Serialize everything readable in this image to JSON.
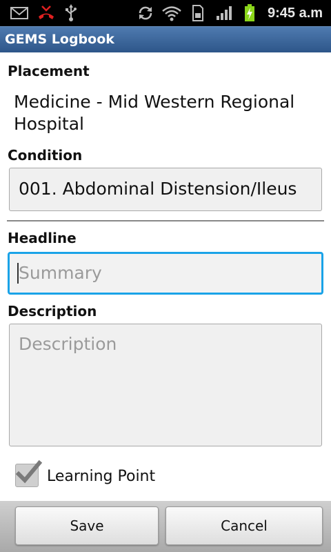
{
  "status_bar": {
    "time": "9:45 a.m",
    "icons": [
      "gmail-icon",
      "missed-call-icon",
      "usb-icon",
      "sync-icon",
      "wifi-icon",
      "sd-card-icon",
      "signal-icon",
      "battery-charging-icon"
    ]
  },
  "app": {
    "title": "GEMS Logbook"
  },
  "form": {
    "placement_label": "Placement",
    "placement_value": "Medicine - Mid Western Regional Hospital",
    "condition_label": "Condition",
    "condition_value": "001. Abdominal Distension/Ileus",
    "headline_label": "Headline",
    "headline_placeholder": "Summary",
    "description_label": "Description",
    "description_placeholder": "Description",
    "learning_point_label": "Learning Point",
    "learning_point_checked": true
  },
  "buttons": {
    "save": "Save",
    "cancel": "Cancel"
  },
  "colors": {
    "title_bar": "#2d5689",
    "focus_border": "#1aa3e8",
    "status_bar": "#000000"
  }
}
